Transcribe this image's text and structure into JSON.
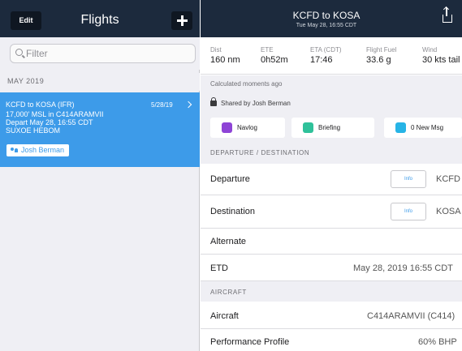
{
  "left": {
    "edit_label": "Edit",
    "title": "Flights",
    "filter_placeholder": "Filter",
    "section": "MAY 2019",
    "flight": {
      "title": "KCFD to KOSA (IFR)",
      "date": "5/28/19",
      "line1": "17,000' MSL in C414ARAMVII",
      "line2": "Depart May 28, 16:55 CDT",
      "line3": "SUXOE HEBOM",
      "pilot": "Josh Berman"
    }
  },
  "right": {
    "title": "KCFD to KOSA",
    "subtitle": "Tue May 28, 16:55 CDT",
    "stats": [
      {
        "label": "Dist",
        "value": "160 nm"
      },
      {
        "label": "ETE",
        "value": "0h52m"
      },
      {
        "label": "ETA (CDT)",
        "value": "17:46"
      },
      {
        "label": "Flight Fuel",
        "value": "33.6 g"
      },
      {
        "label": "Wind",
        "value": "30 kts tail"
      }
    ],
    "calculated": "Calculated moments ago",
    "shared_by": "Shared by Josh Berman",
    "buttons": [
      {
        "label": "Navlog",
        "color": "#8e44d6"
      },
      {
        "label": "Briefing",
        "color": "#2fc19a"
      },
      {
        "label": "0 New Msg",
        "color": "#27b4e6"
      }
    ],
    "section_departure": "DEPARTURE / DESTINATION",
    "departure_label": "Departure",
    "departure_info": "Info",
    "departure_value": "KCFD",
    "destination_label": "Destination",
    "destination_info": "Info",
    "destination_value": "KOSA",
    "alternate_label": "Alternate",
    "etd_label": "ETD",
    "etd_value": "May 28, 2019 16:55 CDT",
    "section_aircraft": "AIRCRAFT",
    "aircraft_label": "Aircraft",
    "aircraft_value": "C414ARAMVII (C414)",
    "perf_label": "Performance Profile",
    "perf_value": "60% BHP"
  },
  "colors": {
    "header": "#1c2a3d",
    "selected": "#3d9be9",
    "background": "#efeff4"
  }
}
